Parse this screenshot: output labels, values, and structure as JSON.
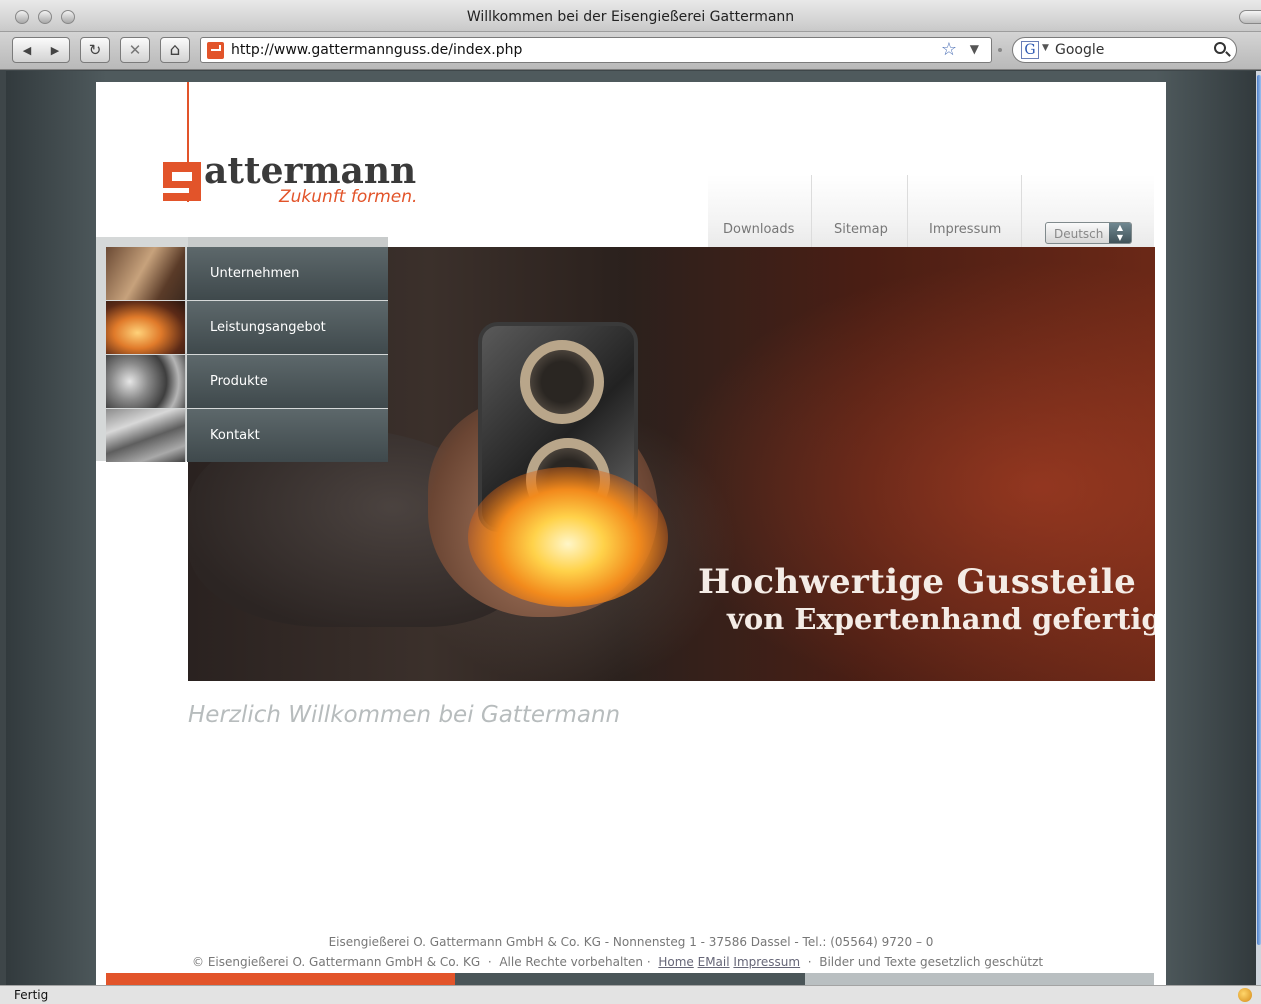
{
  "browser": {
    "window_title": "Willkommen bei der Eisengießerei Gattermann",
    "url": "http://www.gattermannguss.de/index.php",
    "search_engine": "Google",
    "status": "Fertig",
    "icons": {
      "back": "◀",
      "forward": "▶",
      "reload": "↻",
      "stop": "✕",
      "home": "⌂",
      "bookmark_star": "☆",
      "dropdown": "▼",
      "search_engine_glyph": "G"
    }
  },
  "site": {
    "logo": {
      "name": "attermann",
      "slogan": "Zukunft formen."
    },
    "top_nav": [
      {
        "label": "Downloads"
      },
      {
        "label": "Sitemap"
      },
      {
        "label": "Impressum"
      }
    ],
    "language": "Deutsch",
    "menu": [
      {
        "label": "Unternehmen"
      },
      {
        "label": "Leistungsangebot"
      },
      {
        "label": "Produkte"
      },
      {
        "label": "Kontakt"
      }
    ],
    "hero": {
      "headline_1": "Hochwertige Gussteile",
      "headline_2": "von Expertenhand gefertigt"
    },
    "welcome": "Herzlich Willkommen bei Gattermann",
    "footer": {
      "address": "Eisengießerei O. Gattermann GmbH & Co. KG - Nonnensteg 1 - 37586 Dassel - Tel.: (05564) 9720 – 0",
      "copyright": "© Eisengießerei O. Gattermann GmbH & Co. KG",
      "rights": "Alle Rechte vorbehalten",
      "links": [
        "Home",
        "EMail",
        "Impressum"
      ],
      "protected": "Bilder und Texte gesetzlich geschützt",
      "sep": "·"
    },
    "colors": {
      "brand_orange": "#e2542a",
      "menu_dark": "#4a5558",
      "footer_grey": "#b9bfc1"
    }
  }
}
